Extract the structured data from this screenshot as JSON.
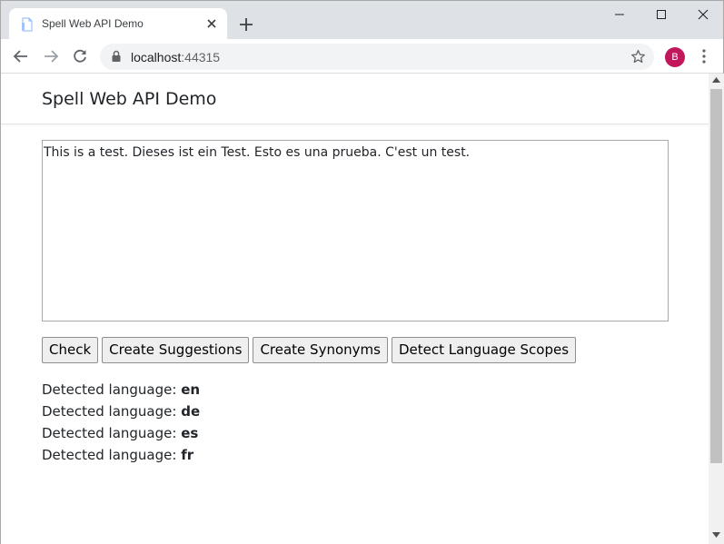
{
  "browser": {
    "tab_title": "Spell Web API Demo",
    "url_host": "localhost",
    "url_port": ":44315",
    "profile_initial": "B",
    "profile_color": "#c2185b"
  },
  "page": {
    "brand": "Spell Web API Demo",
    "editor_text": "This is a test. Dieses ist ein Test. Esto es una prueba. C'est un test.",
    "buttons": {
      "check": "Check",
      "suggestions": "Create Suggestions",
      "synonyms": "Create Synonyms",
      "scopes": "Detect Language Scopes"
    },
    "results_label": "Detected language: ",
    "results": [
      {
        "code": "en"
      },
      {
        "code": "de"
      },
      {
        "code": "es"
      },
      {
        "code": "fr"
      }
    ]
  },
  "icons": [
    "page-icon",
    "close-icon",
    "plus-icon",
    "minimize-icon",
    "maximize-icon",
    "window-close-icon",
    "back-arrow-icon",
    "forward-arrow-icon",
    "reload-icon",
    "lock-icon",
    "star-icon",
    "kebab-menu-icon"
  ]
}
